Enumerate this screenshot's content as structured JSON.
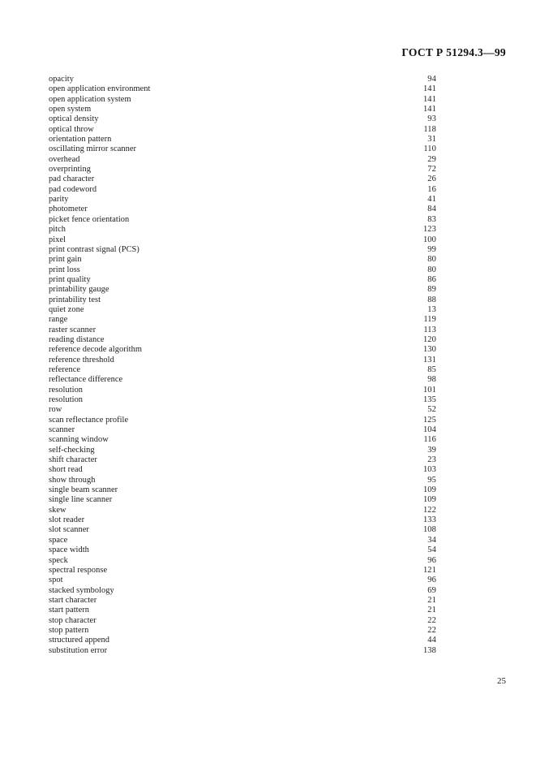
{
  "header": {
    "standard_number": "ГОСТ Р 51294.3—99"
  },
  "footer": {
    "page_number": "25"
  },
  "index": {
    "entries": [
      {
        "term": "opacity",
        "page": "94"
      },
      {
        "term": "open application environment",
        "page": "141"
      },
      {
        "term": "open application system",
        "page": "141"
      },
      {
        "term": "open system",
        "page": "141"
      },
      {
        "term": "optical density",
        "page": "93"
      },
      {
        "term": "optical throw",
        "page": "118"
      },
      {
        "term": "orientation pattern",
        "page": "31"
      },
      {
        "term": "oscillating mirror scanner",
        "page": "110"
      },
      {
        "term": "overhead",
        "page": "29"
      },
      {
        "term": "overprinting",
        "page": "72"
      },
      {
        "term": "pad character",
        "page": "26"
      },
      {
        "term": "pad codeword",
        "page": "16"
      },
      {
        "term": "parity",
        "page": "41"
      },
      {
        "term": "photometer",
        "page": "84"
      },
      {
        "term": "picket fence orientation",
        "page": "83"
      },
      {
        "term": "pitch",
        "page": "123"
      },
      {
        "term": "pixel",
        "page": "100"
      },
      {
        "term": "print contrast signal (PCS)",
        "page": "99"
      },
      {
        "term": "print gain",
        "page": "80"
      },
      {
        "term": "print loss",
        "page": "80"
      },
      {
        "term": "print quality",
        "page": "86"
      },
      {
        "term": "printability gauge",
        "page": "89"
      },
      {
        "term": "printability test",
        "page": "88"
      },
      {
        "term": "quiet zone",
        "page": "13"
      },
      {
        "term": "range",
        "page": "119"
      },
      {
        "term": "raster scanner",
        "page": "113"
      },
      {
        "term": "reading distance",
        "page": "120"
      },
      {
        "term": "reference decode algorithm",
        "page": "130"
      },
      {
        "term": "reference threshold",
        "page": "131"
      },
      {
        "term": "reference",
        "page": "85"
      },
      {
        "term": "reflectance difference",
        "page": "98"
      },
      {
        "term": "resolution",
        "page": "101"
      },
      {
        "term": "resolution",
        "page": "135"
      },
      {
        "term": "row",
        "page": "52"
      },
      {
        "term": "scan reflectance profile",
        "page": "125"
      },
      {
        "term": "scanner",
        "page": "104"
      },
      {
        "term": "scanning window",
        "page": "116"
      },
      {
        "term": "self-checking",
        "page": "39"
      },
      {
        "term": "shift character",
        "page": "23"
      },
      {
        "term": "short read",
        "page": "103"
      },
      {
        "term": "show through",
        "page": "95"
      },
      {
        "term": "single beam scanner",
        "page": "109"
      },
      {
        "term": "single line scanner",
        "page": "109"
      },
      {
        "term": "skew",
        "page": "122"
      },
      {
        "term": "slot reader",
        "page": "133"
      },
      {
        "term": "slot scanner",
        "page": "108"
      },
      {
        "term": "space",
        "page": "34"
      },
      {
        "term": "space width",
        "page": "54"
      },
      {
        "term": "speck",
        "page": "96"
      },
      {
        "term": "spectral response",
        "page": "121"
      },
      {
        "term": "spot",
        "page": "96"
      },
      {
        "term": "stacked symbology",
        "page": "69"
      },
      {
        "term": "start character",
        "page": "21"
      },
      {
        "term": "start pattern",
        "page": "21"
      },
      {
        "term": "stop character",
        "page": "22"
      },
      {
        "term": "stop pattern",
        "page": "22"
      },
      {
        "term": "structured append",
        "page": "44"
      },
      {
        "term": "substitution error",
        "page": "138"
      }
    ]
  }
}
